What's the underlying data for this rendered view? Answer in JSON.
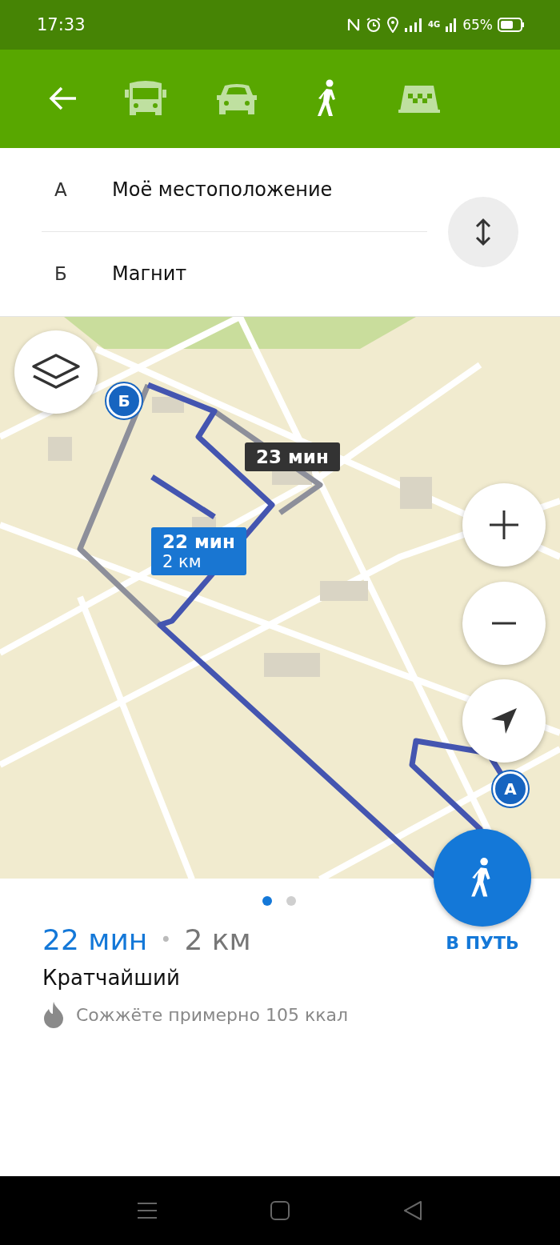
{
  "status_bar": {
    "time": "17:33",
    "network": "4G",
    "battery": "65%"
  },
  "modes": [
    {
      "kind": "bus",
      "selected": false
    },
    {
      "kind": "car",
      "selected": false
    },
    {
      "kind": "walk",
      "selected": true
    },
    {
      "kind": "taxi",
      "selected": false
    }
  ],
  "route_points": [
    {
      "letter": "А",
      "value": "Моё местоположение"
    },
    {
      "letter": "Б",
      "value": "Магнит"
    }
  ],
  "map": {
    "route_labels": [
      {
        "time": "23 мин",
        "selected": false
      },
      {
        "time": "22 мин",
        "distance": "2 км",
        "selected": true
      }
    ],
    "markers": [
      {
        "letter": "Б"
      },
      {
        "letter": "А"
      }
    ]
  },
  "pager": [
    {
      "selected": true
    },
    {
      "selected": false
    }
  ],
  "summary": {
    "duration": "22 мин",
    "separator": "•",
    "distance": "2 км",
    "title": "Кратчайший",
    "calories": "Сожжёте примерно 105 ккал"
  },
  "go_button": "В ПУТЬ"
}
